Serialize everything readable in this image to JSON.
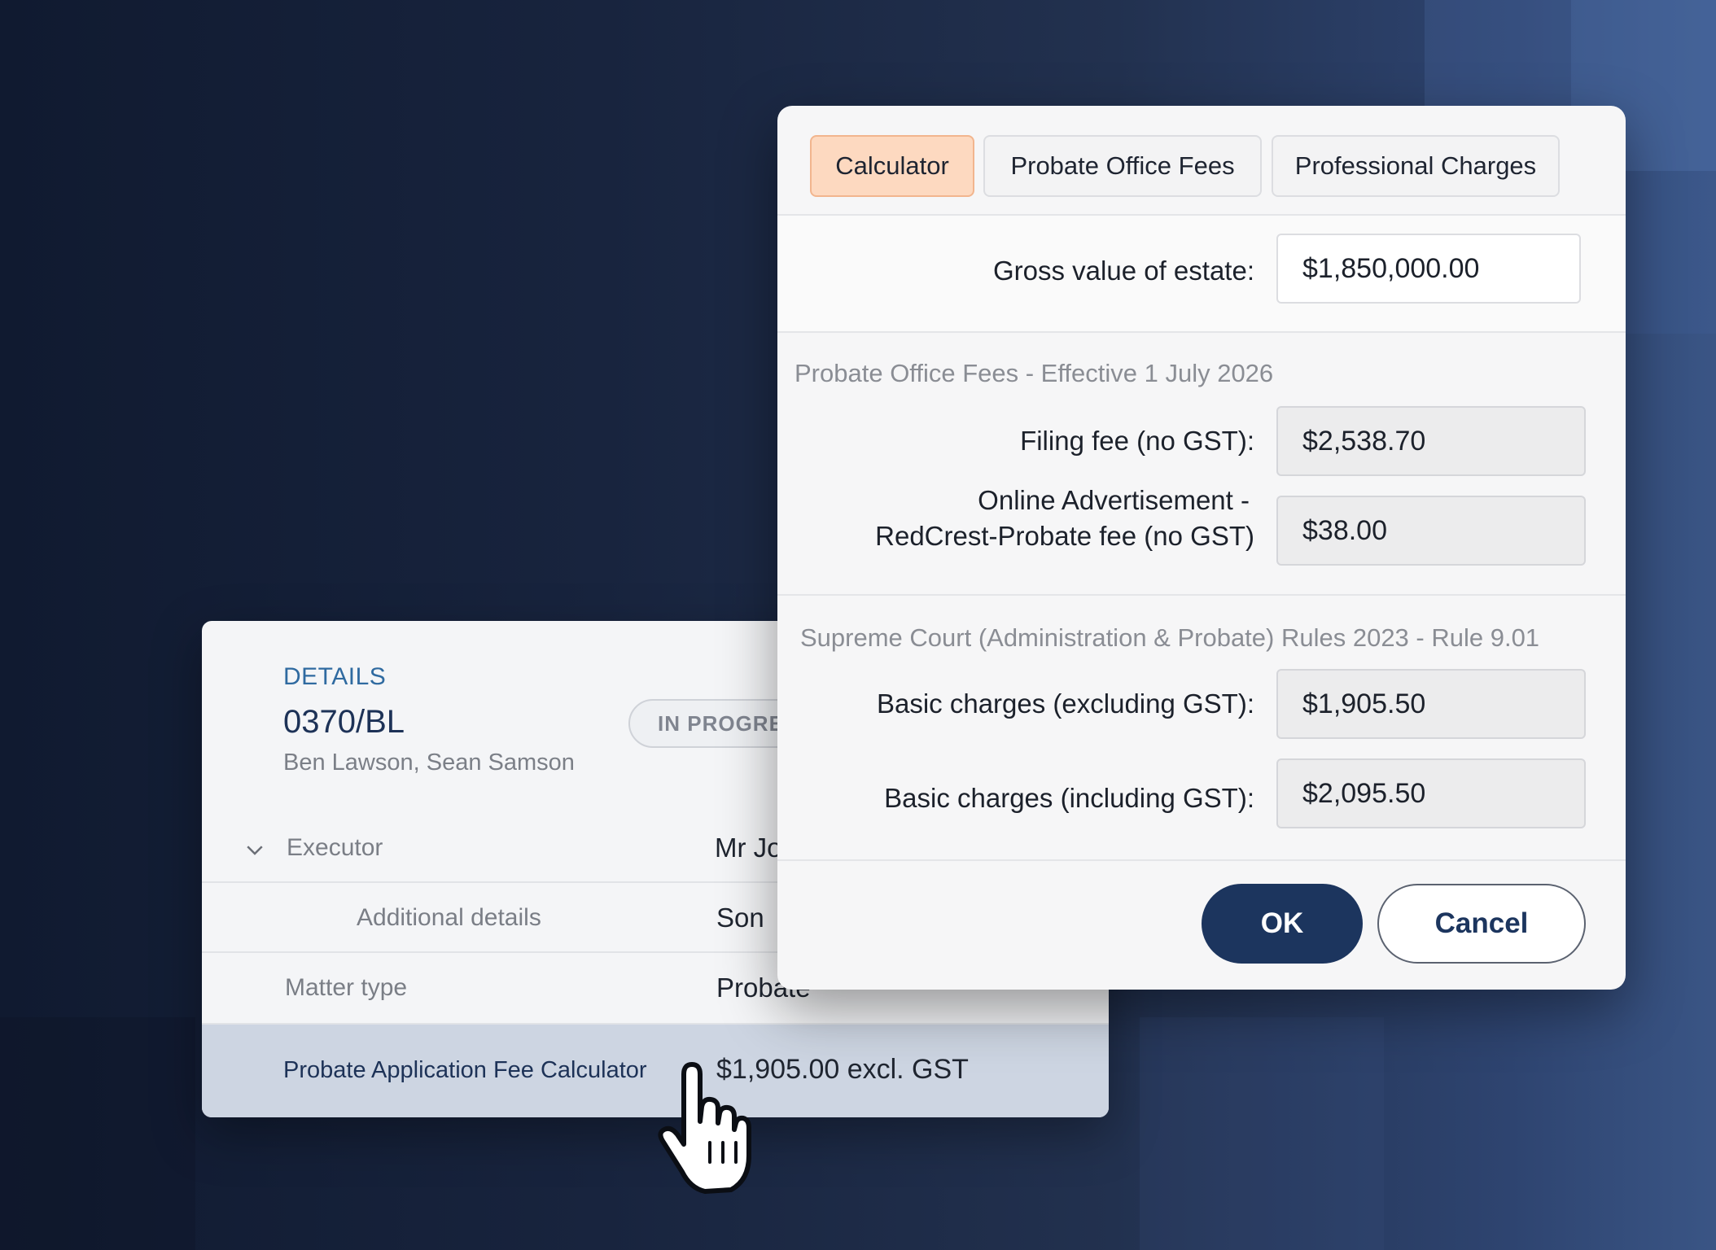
{
  "details": {
    "section_label": "DETAILS",
    "reference": "0370/BL",
    "clients": "Ben Lawson, Sean Samson",
    "status": "IN PROGRESS",
    "rows": [
      {
        "key": "Executor",
        "value": "Mr Jo"
      },
      {
        "key": "Additional details",
        "value": "Son"
      },
      {
        "key": "Matter type",
        "value": "Probate"
      },
      {
        "key": "Probate Application Fee Calculator",
        "value": "$1,905.00 excl. GST"
      }
    ]
  },
  "dialog": {
    "tabs": [
      {
        "label": "Calculator",
        "active": true
      },
      {
        "label": "Probate Office Fees",
        "active": false
      },
      {
        "label": "Professional Charges",
        "active": false
      }
    ],
    "gross_label": "Gross value of estate:",
    "gross_value": "$1,850,000.00",
    "probate_section": {
      "title": "Probate Office Fees - Effective 1 July 2026",
      "filing_label": "Filing fee (no GST):",
      "filing_value": "$2,538.70",
      "ad_label_line1": "Online Advertisement -",
      "ad_label_line2": "RedCrest-Probate fee (no GST)",
      "ad_value": "$38.00"
    },
    "court_section": {
      "title": "Supreme Court (Administration & Probate) Rules 2023 - Rule 9.01",
      "basic_ex_label": "Basic charges (excluding GST):",
      "basic_ex_value": "$1,905.50",
      "basic_inc_label": "Basic charges (including GST):",
      "basic_inc_value": "$2,095.50"
    },
    "ok_label": "OK",
    "cancel_label": "Cancel"
  },
  "colors": {
    "accent_tab": "#fdd9c0",
    "primary_button": "#1c355e",
    "link_text": "#2f6aa0",
    "selected_row": "#cdd5e2"
  }
}
